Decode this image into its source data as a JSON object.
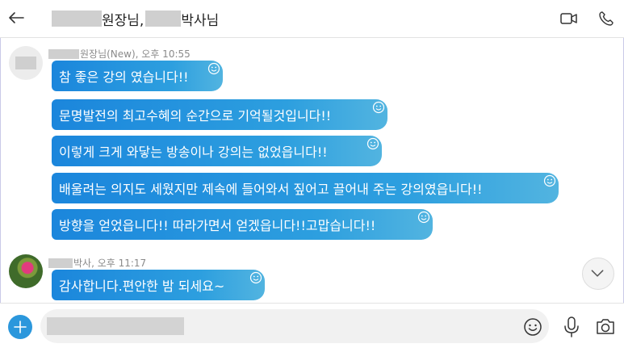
{
  "header": {
    "title_part1": "원장님,",
    "title_part2": "박사님",
    "back_icon": "arrow-left-icon",
    "video_icon": "video-camera-icon",
    "call_icon": "phone-icon"
  },
  "messages": [
    {
      "sender_suffix": "원장님(New), 오후 10:55",
      "bubbles": [
        "참 좋은 강의 였습니다!!",
        "문명발전의 최고수혜의 순간으로 기억될것입니다!!",
        "이렇게 크게 와닿는 방송이나 강의는 없었읍니다!!",
        "배울려는 의지도 세웠지만 제속에 들어와서 짚어고 끌어내 주는 강의였읍니다!!",
        "방향을 얻었읍니다!! 따라가면서 얻겠읍니다!!고맙습니다!!"
      ]
    },
    {
      "sender_suffix": "박사, 오후 11:17",
      "bubbles": [
        "감사합니다.편안한 밤 되세요~"
      ]
    }
  ],
  "compose": {
    "placeholder": ""
  },
  "colors": {
    "bubble_start": "#1b86dc",
    "bubble_end": "#52b4e0",
    "accent": "#2b97dc"
  }
}
